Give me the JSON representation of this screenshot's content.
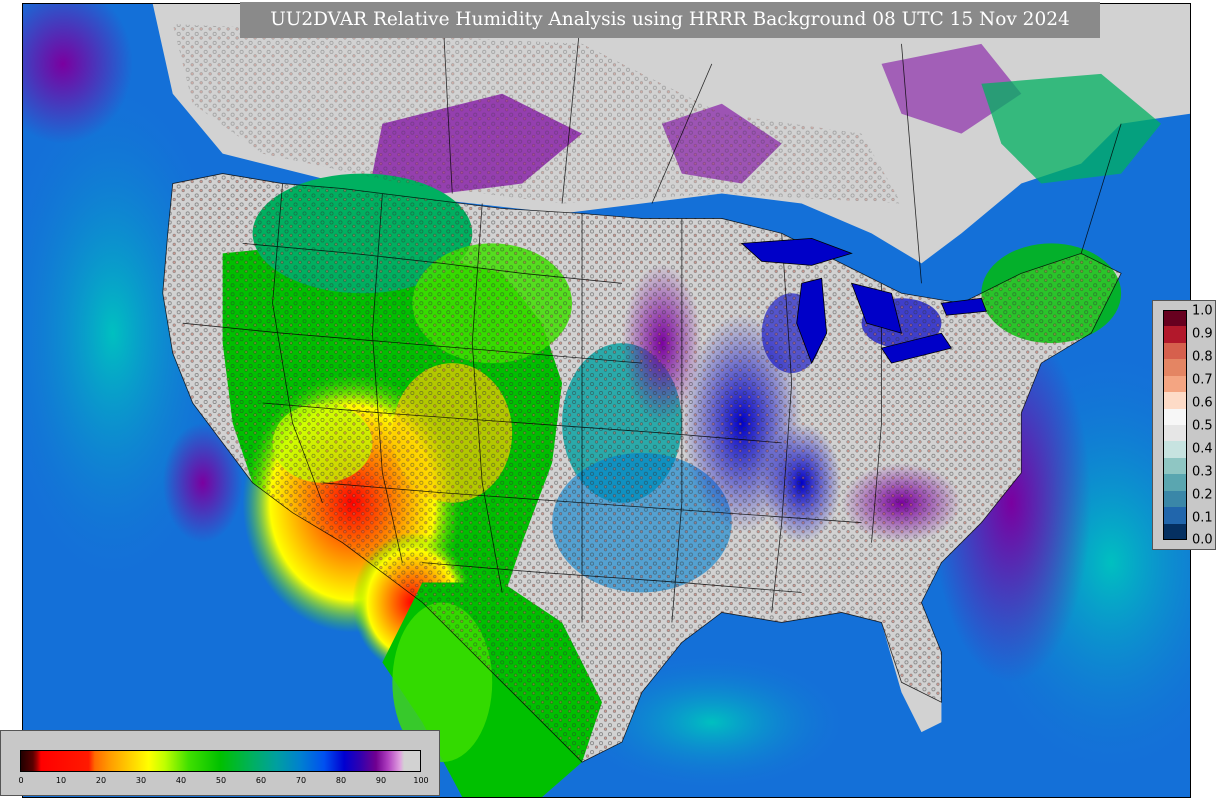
{
  "title": "UU2DVAR Relative Humidity Analysis using HRRR Background 08 UTC 15 Nov 2024",
  "rh_colorbar": {
    "ticks": [
      "0",
      "10",
      "20",
      "30",
      "40",
      "50",
      "60",
      "70",
      "80",
      "90",
      "100"
    ]
  },
  "ratio_colorbar": {
    "ticks": [
      "1.0",
      "0.9",
      "0.8",
      "0.7",
      "0.6",
      "0.5",
      "0.4",
      "0.3",
      "0.2",
      "0.1",
      "0.0"
    ],
    "colors": [
      "#67001f",
      "#b2182b",
      "#d6604d",
      "#e48563",
      "#f4a582",
      "#fddbc7",
      "#f7f7f7",
      "#e6e6e6",
      "#c7e3e0",
      "#8fc6c3",
      "#5aa6b0",
      "#3a87a8",
      "#2166ac",
      "#053061"
    ]
  },
  "colors": {
    "title_bg": "#8a8a8a",
    "ocean": "#1470d8",
    "high_humidity": "#d2d2d2",
    "low_humidity": "#ff0000"
  }
}
